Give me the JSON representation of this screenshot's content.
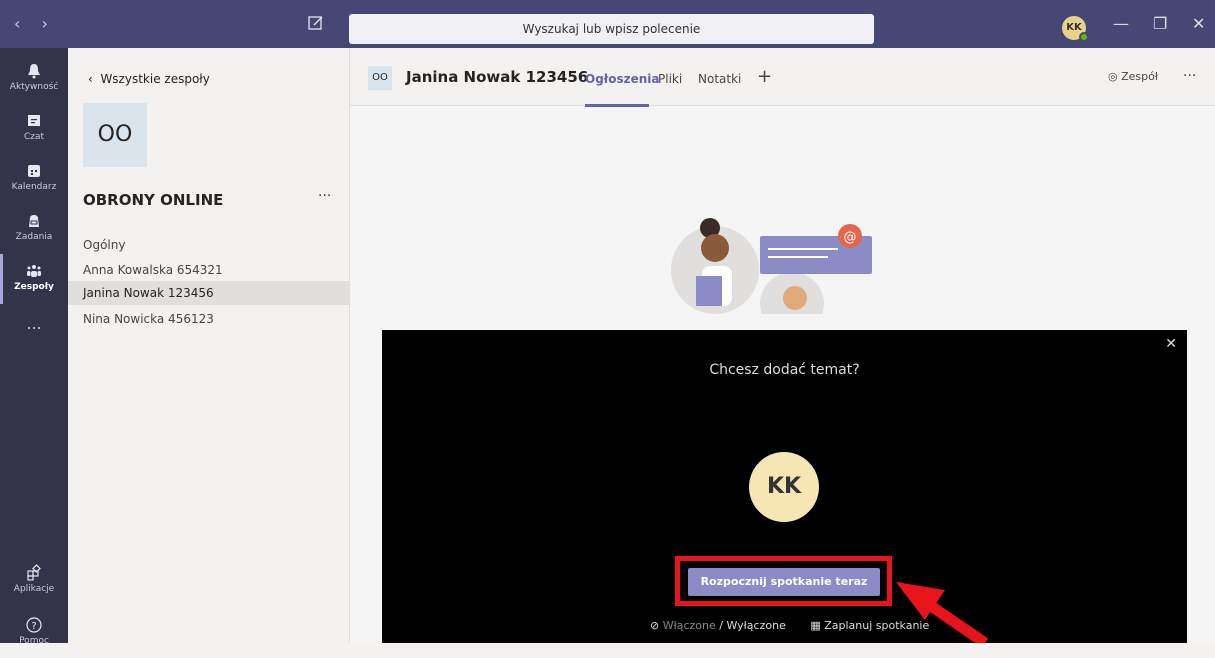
{
  "titlebar": {
    "search_placeholder": "Wyszukaj lub wpisz polecenie",
    "avatar_initials": "KK"
  },
  "rail": {
    "items": [
      {
        "label": "Aktywność",
        "icon": "bell-icon"
      },
      {
        "label": "Czat",
        "icon": "chat-icon"
      },
      {
        "label": "Kalendarz",
        "icon": "calendar-icon"
      },
      {
        "label": "Zadania",
        "icon": "assignments-icon"
      },
      {
        "label": "Zespoły",
        "icon": "teams-icon",
        "active": true
      }
    ],
    "more": "...",
    "apps_label": "Aplikacje",
    "help_label": "Pomoc"
  },
  "teampanel": {
    "back_label": "Wszystkie zespoły",
    "tile_initials": "OO",
    "team_name": "OBRONY ONLINE",
    "channels": [
      {
        "name": "Ogólny"
      },
      {
        "name": "Anna Kowalska 654321"
      },
      {
        "name": "Janina Nowak 123456",
        "selected": true
      },
      {
        "name": "Nina Nowicka 456123"
      }
    ]
  },
  "main": {
    "tile_initials": "OO",
    "title": "Janina Nowak 123456",
    "tabs": [
      "Ogłoszenia",
      "Pliki",
      "Notatki"
    ],
    "active_tab": "Ogłoszenia",
    "team_button": "Zespół"
  },
  "modal": {
    "question": "Chcesz dodać temat?",
    "avatar_initials": "KK",
    "start_button": "Rozpocznij spotkanie teraz",
    "on_label": "Włączone",
    "separator": "/",
    "off_label": "Wyłączone",
    "schedule_label": "Zaplanuj spotkanie"
  },
  "colors": {
    "accent": "#6264a7",
    "titlebar": "#464775",
    "rail": "#33344a",
    "highlight": "#e8141b"
  }
}
